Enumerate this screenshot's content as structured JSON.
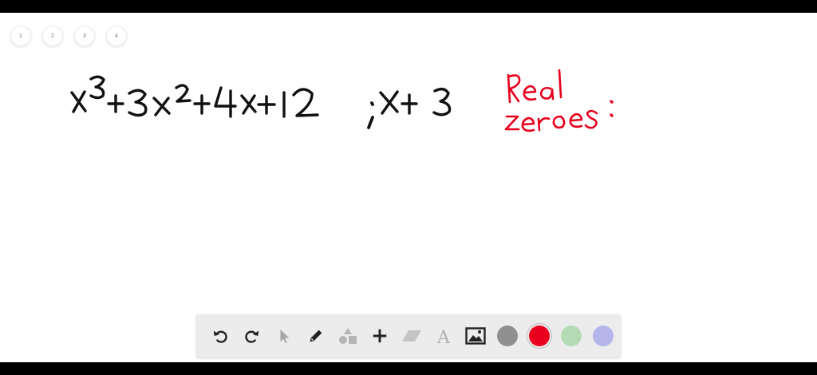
{
  "pages": [
    "1",
    "2",
    "3",
    "4"
  ],
  "board": {
    "expression": "x³+3x²+4x+12 ; x+3",
    "note_line1": "Real",
    "note_line2": "zeroes:"
  },
  "toolbar": {
    "tools": [
      "undo-icon",
      "redo-icon",
      "select-pointer-icon",
      "pencil-icon",
      "shapes-icon",
      "add-icon",
      "eraser-icon",
      "text-icon",
      "image-icon"
    ],
    "colors": [
      "#8f8f8f",
      "#e8001c",
      "#b4dbb4",
      "#b6b6ec"
    ],
    "selected_color": "#e8001c"
  }
}
